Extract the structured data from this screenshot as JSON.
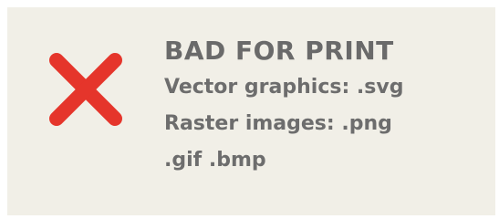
{
  "card": {
    "icon": "red-x-icon",
    "icon_color": "#e5352b",
    "background_color": "#f1efe7",
    "title": "BAD FOR PRINT",
    "lines": [
      "Vector graphics: .svg",
      "Raster images: .png",
      ".gif .bmp"
    ]
  }
}
